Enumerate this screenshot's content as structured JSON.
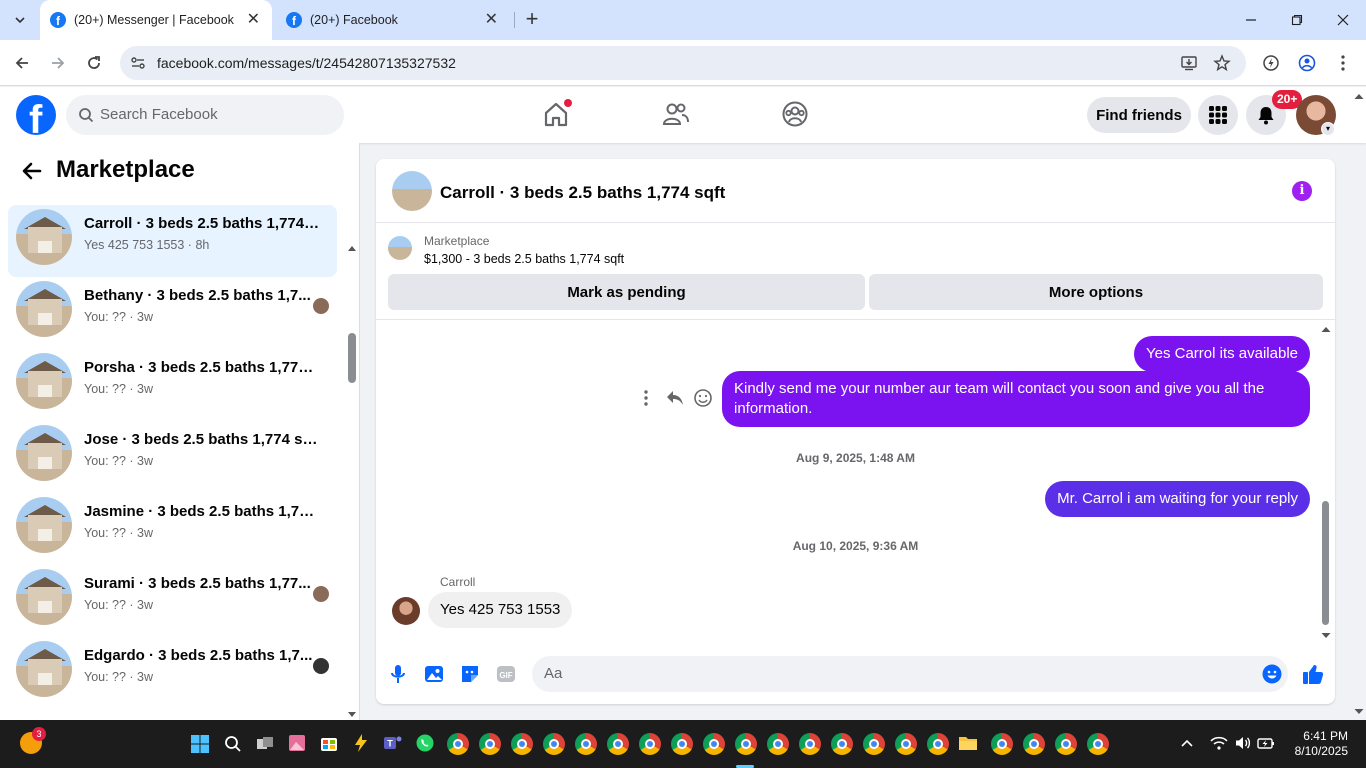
{
  "browser": {
    "tabs": [
      {
        "title": "(20+) Messenger | Facebook",
        "active": true
      },
      {
        "title": "(20+) Facebook",
        "active": false
      }
    ],
    "url": "facebook.com/messages/t/24542807135327532"
  },
  "fbnav": {
    "search_placeholder": "Search Facebook",
    "find_friends_label": "Find friends",
    "notification_count": "20+"
  },
  "sidebar": {
    "title": "Marketplace",
    "conversations": [
      {
        "name": "Carroll · 3 beds 2.5 baths 1,774 s...",
        "preview": "Yes 425 753 1553 · 8h",
        "active": true,
        "has_avatar": false
      },
      {
        "name": "Bethany · 3 beds 2.5 baths 1,7...",
        "preview": "You: ?? · 3w",
        "active": false,
        "has_avatar": true
      },
      {
        "name": "Porsha · 3 beds 2.5 baths 1,774 s...",
        "preview": "You: ?? · 3w",
        "active": false,
        "has_avatar": false
      },
      {
        "name": "Jose · 3 beds 2.5 baths 1,774 sqft",
        "preview": "You: ?? · 3w",
        "active": false,
        "has_avatar": false
      },
      {
        "name": "Jasmine · 3 beds 2.5 baths 1,774 ...",
        "preview": "You: ?? · 3w",
        "active": false,
        "has_avatar": false
      },
      {
        "name": "Surami · 3 beds 2.5 baths 1,77...",
        "preview": "You: ?? · 3w",
        "active": false,
        "has_avatar": true
      },
      {
        "name": "Edgardo · 3 beds 2.5 baths 1,7...",
        "preview": "You: ?? · 3w",
        "active": false,
        "has_avatar": true
      }
    ]
  },
  "chat": {
    "title": "Carroll · 3 beds 2.5 baths 1,774 sqft",
    "marketplace_label": "Marketplace",
    "listing": "$1,300 - 3 beds 2.5 baths 1,774 sqft",
    "mark_pending_label": "Mark as pending",
    "more_options_label": "More options",
    "messages": {
      "out1": "Yes Carrol its available",
      "out2": "Kindly send me your number aur team will contact you soon and give you all the information.",
      "ts1": "Aug 9, 2025, 1:48 AM",
      "out3": "Mr. Carrol i am waiting for your reply",
      "ts2": "Aug 10, 2025, 9:36 AM",
      "sender": "Carroll",
      "in1": "Yes 425 753 1553"
    },
    "composer_placeholder": "Aa"
  },
  "taskbar": {
    "weather_badge": "3",
    "time": "6:41 PM",
    "date": "8/10/2025"
  },
  "colors": {
    "fb_blue": "#0866ff",
    "outgoing_bubble": "#7b12f0",
    "mr_carrol_bubble": "#5b2ee8",
    "active_conversation": "#e7f3ff",
    "notification_red": "#e41e3f"
  }
}
